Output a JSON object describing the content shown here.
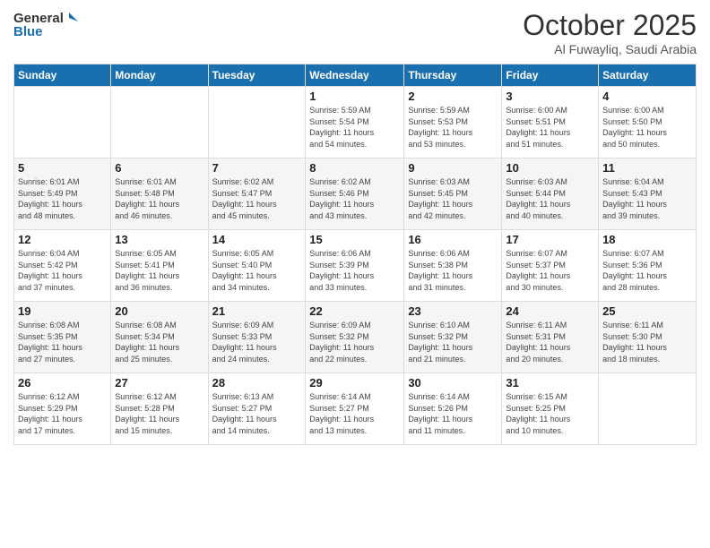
{
  "header": {
    "logo_line1": "General",
    "logo_line2": "Blue",
    "month": "October 2025",
    "location": "Al Fuwayliq, Saudi Arabia"
  },
  "weekdays": [
    "Sunday",
    "Monday",
    "Tuesday",
    "Wednesday",
    "Thursday",
    "Friday",
    "Saturday"
  ],
  "weeks": [
    [
      {
        "day": "",
        "info": ""
      },
      {
        "day": "",
        "info": ""
      },
      {
        "day": "",
        "info": ""
      },
      {
        "day": "1",
        "info": "Sunrise: 5:59 AM\nSunset: 5:54 PM\nDaylight: 11 hours\nand 54 minutes."
      },
      {
        "day": "2",
        "info": "Sunrise: 5:59 AM\nSunset: 5:53 PM\nDaylight: 11 hours\nand 53 minutes."
      },
      {
        "day": "3",
        "info": "Sunrise: 6:00 AM\nSunset: 5:51 PM\nDaylight: 11 hours\nand 51 minutes."
      },
      {
        "day": "4",
        "info": "Sunrise: 6:00 AM\nSunset: 5:50 PM\nDaylight: 11 hours\nand 50 minutes."
      }
    ],
    [
      {
        "day": "5",
        "info": "Sunrise: 6:01 AM\nSunset: 5:49 PM\nDaylight: 11 hours\nand 48 minutes."
      },
      {
        "day": "6",
        "info": "Sunrise: 6:01 AM\nSunset: 5:48 PM\nDaylight: 11 hours\nand 46 minutes."
      },
      {
        "day": "7",
        "info": "Sunrise: 6:02 AM\nSunset: 5:47 PM\nDaylight: 11 hours\nand 45 minutes."
      },
      {
        "day": "8",
        "info": "Sunrise: 6:02 AM\nSunset: 5:46 PM\nDaylight: 11 hours\nand 43 minutes."
      },
      {
        "day": "9",
        "info": "Sunrise: 6:03 AM\nSunset: 5:45 PM\nDaylight: 11 hours\nand 42 minutes."
      },
      {
        "day": "10",
        "info": "Sunrise: 6:03 AM\nSunset: 5:44 PM\nDaylight: 11 hours\nand 40 minutes."
      },
      {
        "day": "11",
        "info": "Sunrise: 6:04 AM\nSunset: 5:43 PM\nDaylight: 11 hours\nand 39 minutes."
      }
    ],
    [
      {
        "day": "12",
        "info": "Sunrise: 6:04 AM\nSunset: 5:42 PM\nDaylight: 11 hours\nand 37 minutes."
      },
      {
        "day": "13",
        "info": "Sunrise: 6:05 AM\nSunset: 5:41 PM\nDaylight: 11 hours\nand 36 minutes."
      },
      {
        "day": "14",
        "info": "Sunrise: 6:05 AM\nSunset: 5:40 PM\nDaylight: 11 hours\nand 34 minutes."
      },
      {
        "day": "15",
        "info": "Sunrise: 6:06 AM\nSunset: 5:39 PM\nDaylight: 11 hours\nand 33 minutes."
      },
      {
        "day": "16",
        "info": "Sunrise: 6:06 AM\nSunset: 5:38 PM\nDaylight: 11 hours\nand 31 minutes."
      },
      {
        "day": "17",
        "info": "Sunrise: 6:07 AM\nSunset: 5:37 PM\nDaylight: 11 hours\nand 30 minutes."
      },
      {
        "day": "18",
        "info": "Sunrise: 6:07 AM\nSunset: 5:36 PM\nDaylight: 11 hours\nand 28 minutes."
      }
    ],
    [
      {
        "day": "19",
        "info": "Sunrise: 6:08 AM\nSunset: 5:35 PM\nDaylight: 11 hours\nand 27 minutes."
      },
      {
        "day": "20",
        "info": "Sunrise: 6:08 AM\nSunset: 5:34 PM\nDaylight: 11 hours\nand 25 minutes."
      },
      {
        "day": "21",
        "info": "Sunrise: 6:09 AM\nSunset: 5:33 PM\nDaylight: 11 hours\nand 24 minutes."
      },
      {
        "day": "22",
        "info": "Sunrise: 6:09 AM\nSunset: 5:32 PM\nDaylight: 11 hours\nand 22 minutes."
      },
      {
        "day": "23",
        "info": "Sunrise: 6:10 AM\nSunset: 5:32 PM\nDaylight: 11 hours\nand 21 minutes."
      },
      {
        "day": "24",
        "info": "Sunrise: 6:11 AM\nSunset: 5:31 PM\nDaylight: 11 hours\nand 20 minutes."
      },
      {
        "day": "25",
        "info": "Sunrise: 6:11 AM\nSunset: 5:30 PM\nDaylight: 11 hours\nand 18 minutes."
      }
    ],
    [
      {
        "day": "26",
        "info": "Sunrise: 6:12 AM\nSunset: 5:29 PM\nDaylight: 11 hours\nand 17 minutes."
      },
      {
        "day": "27",
        "info": "Sunrise: 6:12 AM\nSunset: 5:28 PM\nDaylight: 11 hours\nand 15 minutes."
      },
      {
        "day": "28",
        "info": "Sunrise: 6:13 AM\nSunset: 5:27 PM\nDaylight: 11 hours\nand 14 minutes."
      },
      {
        "day": "29",
        "info": "Sunrise: 6:14 AM\nSunset: 5:27 PM\nDaylight: 11 hours\nand 13 minutes."
      },
      {
        "day": "30",
        "info": "Sunrise: 6:14 AM\nSunset: 5:26 PM\nDaylight: 11 hours\nand 11 minutes."
      },
      {
        "day": "31",
        "info": "Sunrise: 6:15 AM\nSunset: 5:25 PM\nDaylight: 11 hours\nand 10 minutes."
      },
      {
        "day": "",
        "info": ""
      }
    ]
  ]
}
